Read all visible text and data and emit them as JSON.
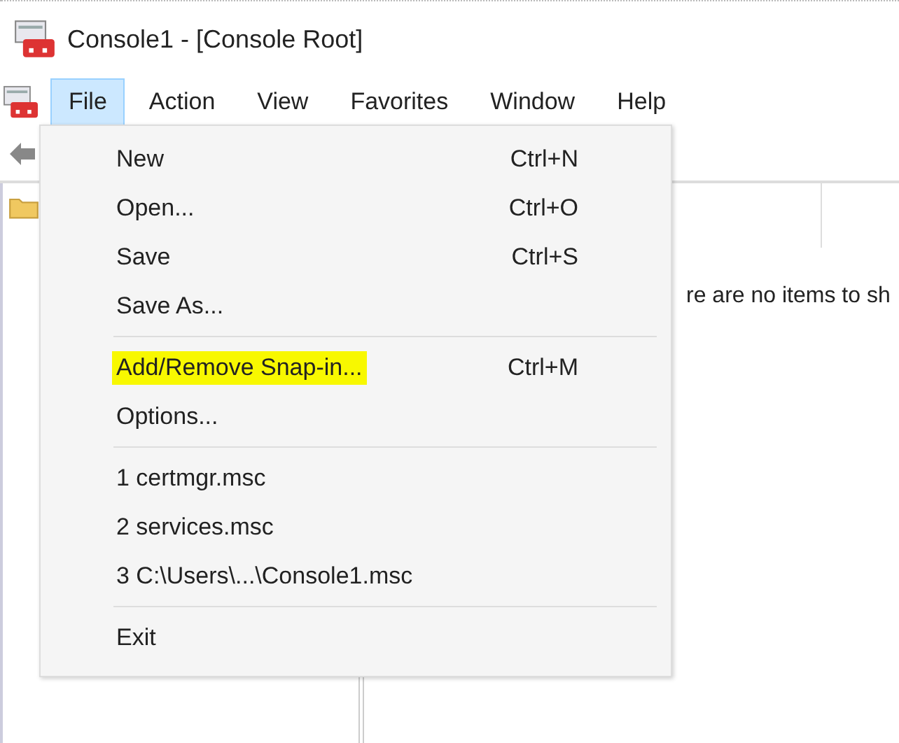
{
  "window": {
    "title": "Console1 - [Console Root]"
  },
  "menu_bar": [
    {
      "label": "File",
      "selected": true
    },
    {
      "label": "Action",
      "selected": false
    },
    {
      "label": "View",
      "selected": false
    },
    {
      "label": "Favorites",
      "selected": false
    },
    {
      "label": "Window",
      "selected": false
    },
    {
      "label": "Help",
      "selected": false
    }
  ],
  "result_pane": {
    "message": "re are no items to sh"
  },
  "file_menu": [
    {
      "kind": "item",
      "label": "New",
      "shortcut": "Ctrl+N",
      "highlighted": false
    },
    {
      "kind": "item",
      "label": "Open...",
      "shortcut": "Ctrl+O",
      "highlighted": false
    },
    {
      "kind": "item",
      "label": "Save",
      "shortcut": "Ctrl+S",
      "highlighted": false
    },
    {
      "kind": "item",
      "label": "Save As...",
      "highlighted": false
    },
    {
      "kind": "separator"
    },
    {
      "kind": "item",
      "label": "Add/Remove Snap-in...",
      "shortcut": "Ctrl+M",
      "highlighted": true
    },
    {
      "kind": "item",
      "label": "Options...",
      "highlighted": false
    },
    {
      "kind": "separator"
    },
    {
      "kind": "item",
      "label": "1 certmgr.msc",
      "highlighted": false
    },
    {
      "kind": "item",
      "label": "2 services.msc",
      "highlighted": false
    },
    {
      "kind": "item",
      "label": "3 C:\\Users\\...\\Console1.msc",
      "highlighted": false
    },
    {
      "kind": "separator"
    },
    {
      "kind": "item",
      "label": "Exit",
      "highlighted": false
    }
  ]
}
